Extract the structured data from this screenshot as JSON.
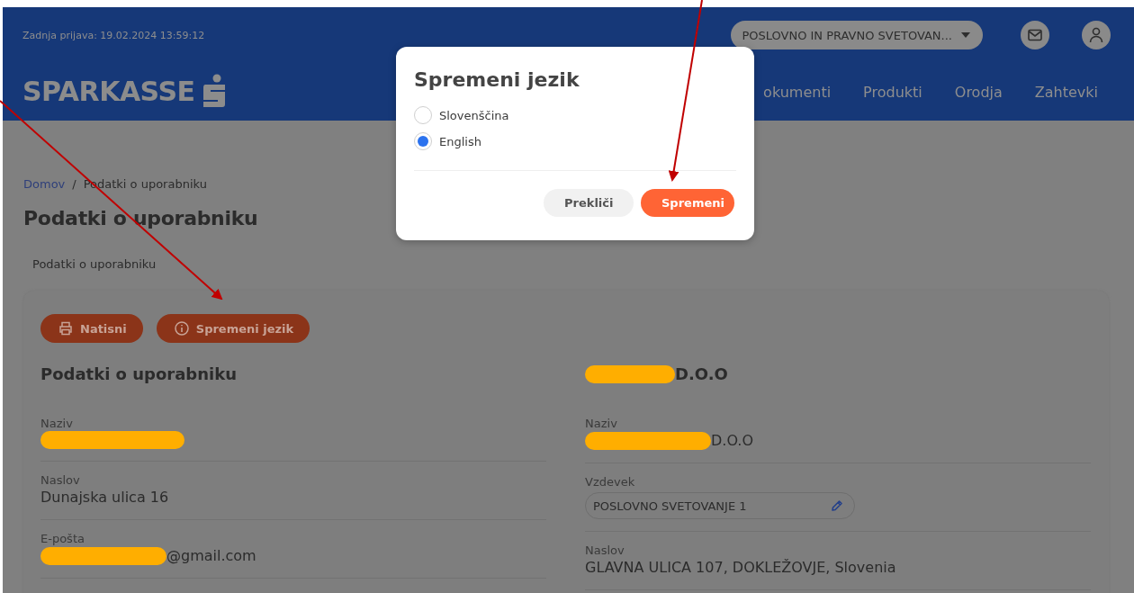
{
  "header": {
    "last_login": "Zadnja prijava: 19.02.2024 13:59:12",
    "logo": "SPARKASSE",
    "account_selector": "POSLOVNO IN PRAVNO SVETOVAN...",
    "nav": [
      {
        "label": "okumenti"
      },
      {
        "label": "Produkti"
      },
      {
        "label": "Orodja"
      },
      {
        "label": "Zahtevki"
      }
    ]
  },
  "breadcrumb": [
    {
      "label": "Domov",
      "kind": "link"
    },
    {
      "label": "Podatki o uporabniku",
      "kind": "current"
    }
  ],
  "breadcrumb_separator": "/",
  "page_title": "Podatki o uporabniku",
  "section_tab": "Podatki o uporabniku",
  "actions": [
    {
      "label": "Natisni",
      "kind": "print"
    },
    {
      "label": "Spremeni jezik",
      "kind": "info"
    }
  ],
  "user_panel": {
    "heading": "Podatki o uporabniku",
    "fields": [
      {
        "label": "Naziv",
        "redacted": true
      },
      {
        "label": "Naslov",
        "value": "Dunajska ulica 16",
        "redacted": false
      },
      {
        "label": "E-pošta",
        "value": "@gmail.com",
        "redacted": true
      }
    ]
  },
  "company_panel": {
    "heading": "D.O.O",
    "heading_redacted": true,
    "fields": [
      {
        "label": "Naziv",
        "value": "D.O.O",
        "kind": "text",
        "redacted": true
      },
      {
        "label": "Vzdevek",
        "value": "POSLOVNO SVETOVANJE 1",
        "kind": "editable",
        "redacted": false
      },
      {
        "label": "Naslov",
        "value": "GLAVNA ULICA 107, DOKLEŽOVJE, Slovenia",
        "kind": "text",
        "redacted": false
      }
    ]
  },
  "dialog": {
    "title": "Spremeni jezik",
    "options": [
      {
        "label": "Slovenščina",
        "selected": false
      },
      {
        "label": "English",
        "selected": true
      }
    ],
    "buttons": [
      {
        "label": "Prekliči",
        "kind": "secondary"
      },
      {
        "label": "Spremeni",
        "kind": "primary"
      }
    ]
  }
}
